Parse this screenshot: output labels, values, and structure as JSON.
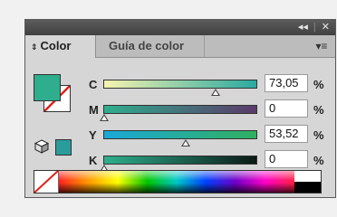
{
  "titlebar": {
    "collapse_icon": "double-chevron-left-icon",
    "close_icon": "close-icon",
    "collapse_glyph": "◂◂",
    "sep_glyph": "|",
    "close_glyph": "✕"
  },
  "tabs": [
    {
      "label": "Color",
      "active": true,
      "arrow": "⇕"
    },
    {
      "label": "Guía de color",
      "active": false
    }
  ],
  "panel_menu_glyph": "▾≡",
  "swatches": {
    "fill_color": "#2fae8e",
    "stroke": "none",
    "gamut_color": "#2a9c9c",
    "gamut_icon": "cube-icon"
  },
  "sliders": [
    {
      "label": "C",
      "value": "73,05",
      "unit": "%",
      "fraction": 0.7305,
      "gradient": [
        "#f7f3b0",
        "#2aa9a0"
      ]
    },
    {
      "label": "M",
      "value": "0",
      "unit": "%",
      "fraction": 0,
      "gradient": [
        "#2fae8e",
        "#5a3a6a"
      ]
    },
    {
      "label": "Y",
      "value": "53,52",
      "unit": "%",
      "fraction": 0.5352,
      "gradient": [
        "#1aa8d8",
        "#30b060"
      ]
    },
    {
      "label": "K",
      "value": "0",
      "unit": "%",
      "fraction": 0,
      "gradient": [
        "#2fae8e",
        "#0a1a14"
      ]
    }
  ],
  "spectrum": {
    "none_icon": "none-swatch-icon"
  }
}
